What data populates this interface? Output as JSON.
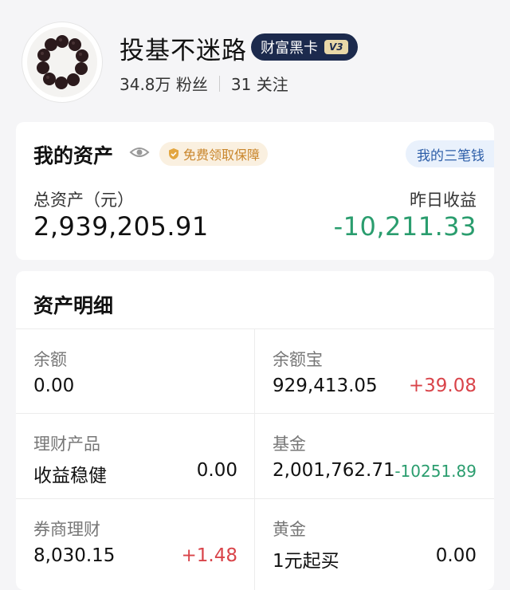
{
  "profile": {
    "name": "投基不迷路",
    "badge_label": "财富黑卡",
    "badge_level": "V3",
    "followers": "34.8万 粉丝",
    "following": "31 关注"
  },
  "assets_card": {
    "title": "我的资产",
    "guarantee_label": "免费领取保障",
    "three_pennies_label": "我的三笔钱",
    "total_label": "总资产（元）",
    "total_value": "2,939,205.91",
    "yesterday_label": "昨日收益",
    "yesterday_value": "-10,211.33"
  },
  "details": {
    "title": "资产明细",
    "items": [
      {
        "label": "余额",
        "value": "0.00",
        "change": ""
      },
      {
        "label": "余额宝",
        "value": "929,413.05",
        "change": "+39.08"
      },
      {
        "label": "理财产品",
        "value": "收益稳健",
        "change": "0.00"
      },
      {
        "label": "基金",
        "value": "2,001,762.71",
        "change": "-10251.89"
      },
      {
        "label": "券商理财",
        "value": "8,030.15",
        "change": "+1.48"
      },
      {
        "label": "黄金",
        "value": "1元起买",
        "change": "0.00"
      }
    ]
  },
  "colors": {
    "loss": "#2a9d6e",
    "gain": "#d9444a",
    "badge_bg": "#1c2a4d"
  },
  "icons": [
    "avatar-bracelet",
    "eye-icon",
    "shield-icon"
  ]
}
